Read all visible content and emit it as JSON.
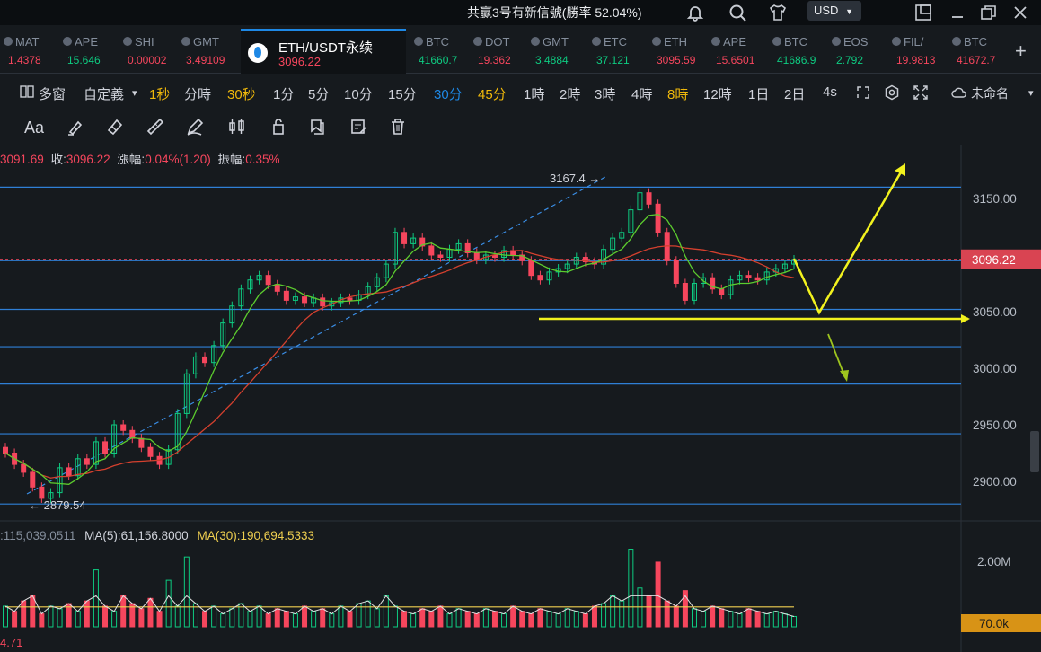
{
  "topbar": {
    "promo": "共赢3号有新信號(勝率 52.04%)",
    "currency": "USD"
  },
  "tickers": [
    {
      "sym": "MAT",
      "px": "1.4378",
      "color": "#f6465d"
    },
    {
      "sym": "APE",
      "px": "15.646",
      "color": "#0ecb81"
    },
    {
      "sym": "SHI",
      "px": "0.00002",
      "color": "#f6465d"
    },
    {
      "sym": "GMT",
      "px": "3.49109",
      "color": "#f6465d"
    },
    {
      "sym": "BTC",
      "px": "41660.7",
      "color": "#0ecb81"
    },
    {
      "sym": "DOT",
      "px": "19.362",
      "color": "#f6465d"
    },
    {
      "sym": "GMT",
      "px": "3.4884",
      "color": "#0ecb81"
    },
    {
      "sym": "ETC",
      "px": "37.121",
      "color": "#0ecb81"
    },
    {
      "sym": "ETH",
      "px": "3095.59",
      "color": "#f6465d"
    },
    {
      "sym": "APE",
      "px": "15.6501",
      "color": "#f6465d"
    },
    {
      "sym": "BTC",
      "px": "41686.9",
      "color": "#0ecb81"
    },
    {
      "sym": "EOS",
      "px": "2.792",
      "color": "#0ecb81"
    },
    {
      "sym": "FIL/",
      "px": "19.9813",
      "color": "#f6465d"
    },
    {
      "sym": "BTC",
      "px": "41672.7",
      "color": "#f6465d"
    }
  ],
  "active_tab": {
    "name": "ETH/USDT永续",
    "price": "3096.22"
  },
  "intervals": {
    "multi_window": "多窗",
    "custom": "自定義",
    "items": [
      "1秒",
      "分時",
      "30秒",
      "1分",
      "5分",
      "10分",
      "15分",
      "30分",
      "45分",
      "1時",
      "2時",
      "3時",
      "4時",
      "8時",
      "12時",
      "1日",
      "2日",
      "4s"
    ],
    "unnamed": "未命名"
  },
  "tools": {
    "font_label": "Aa"
  },
  "ohlc": {
    "open_val": "3091.69",
    "close_label": "收:",
    "close_val": "3096.22",
    "change_label": "漲幅:",
    "change_val": "0.04%(1.20)",
    "amp_label": "振幅:",
    "amp_val": "0.35%"
  },
  "volume_info": {
    "vol": ":115,039.0511",
    "ma5": "MA(5):61,156.8000",
    "ma30": "MA(30):190,694.5333"
  },
  "bottom_value": "4.71",
  "chart_data": {
    "type": "candlestick",
    "price_axis_ticks": [
      "3150.00",
      "3100.00",
      "3050.00",
      "3000.00",
      "2950.00",
      "2900.00"
    ],
    "ylim": [
      2860,
      3185
    ],
    "current_price": "3096.22",
    "high_label": "3167.4 →",
    "low_label": "← 2879.54",
    "high": 3167.4,
    "low": 2879.54,
    "volume_axis_ticks": [
      "2.00M"
    ],
    "volume_marker": "70.0k",
    "horizontal_levels": [
      3160,
      3095,
      3052,
      3019,
      2986,
      2942,
      2880
    ],
    "candles_close": [
      2925,
      2915,
      2908,
      2895,
      2885,
      2890,
      2912,
      2905,
      2920,
      2915,
      2935,
      2925,
      2950,
      2945,
      2938,
      2930,
      2922,
      2915,
      2928,
      2960,
      2995,
      3010,
      3005,
      3020,
      3040,
      3055,
      3070,
      3078,
      3082,
      3074,
      3068,
      3060,
      3063,
      3058,
      3062,
      3055,
      3058,
      3062,
      3060,
      3065,
      3072,
      3080,
      3092,
      3120,
      3110,
      3115,
      3108,
      3100,
      3098,
      3105,
      3110,
      3102,
      3096,
      3100,
      3098,
      3104,
      3100,
      3095,
      3082,
      3078,
      3085,
      3088,
      3092,
      3098,
      3094,
      3092,
      3105,
      3115,
      3120,
      3140,
      3155,
      3145,
      3120,
      3095,
      3075,
      3060,
      3075,
      3080,
      3070,
      3065,
      3078,
      3082,
      3080,
      3078,
      3085,
      3088,
      3092,
      3096
    ],
    "volume": [
      0.08,
      0.06,
      0.1,
      0.12,
      0.05,
      0.08,
      0.07,
      0.09,
      0.06,
      0.1,
      0.22,
      0.08,
      0.06,
      0.12,
      0.09,
      0.07,
      0.11,
      0.06,
      0.18,
      0.08,
      0.27,
      0.09,
      0.06,
      0.08,
      0.05,
      0.07,
      0.09,
      0.06,
      0.08,
      0.05,
      0.07,
      0.06,
      0.05,
      0.08,
      0.06,
      0.07,
      0.05,
      0.08,
      0.06,
      0.09,
      0.1,
      0.07,
      0.12,
      0.08,
      0.06,
      0.05,
      0.07,
      0.06,
      0.08,
      0.05,
      0.07,
      0.06,
      0.05,
      0.07,
      0.06,
      0.05,
      0.08,
      0.06,
      0.05,
      0.07,
      0.06,
      0.05,
      0.07,
      0.06,
      0.05,
      0.08,
      0.09,
      0.12,
      0.1,
      0.3,
      0.15,
      0.12,
      0.25,
      0.1,
      0.08,
      0.14,
      0.07,
      0.06,
      0.08,
      0.07,
      0.06,
      0.05,
      0.07,
      0.06,
      0.05,
      0.06,
      0.05,
      0.04
    ]
  }
}
